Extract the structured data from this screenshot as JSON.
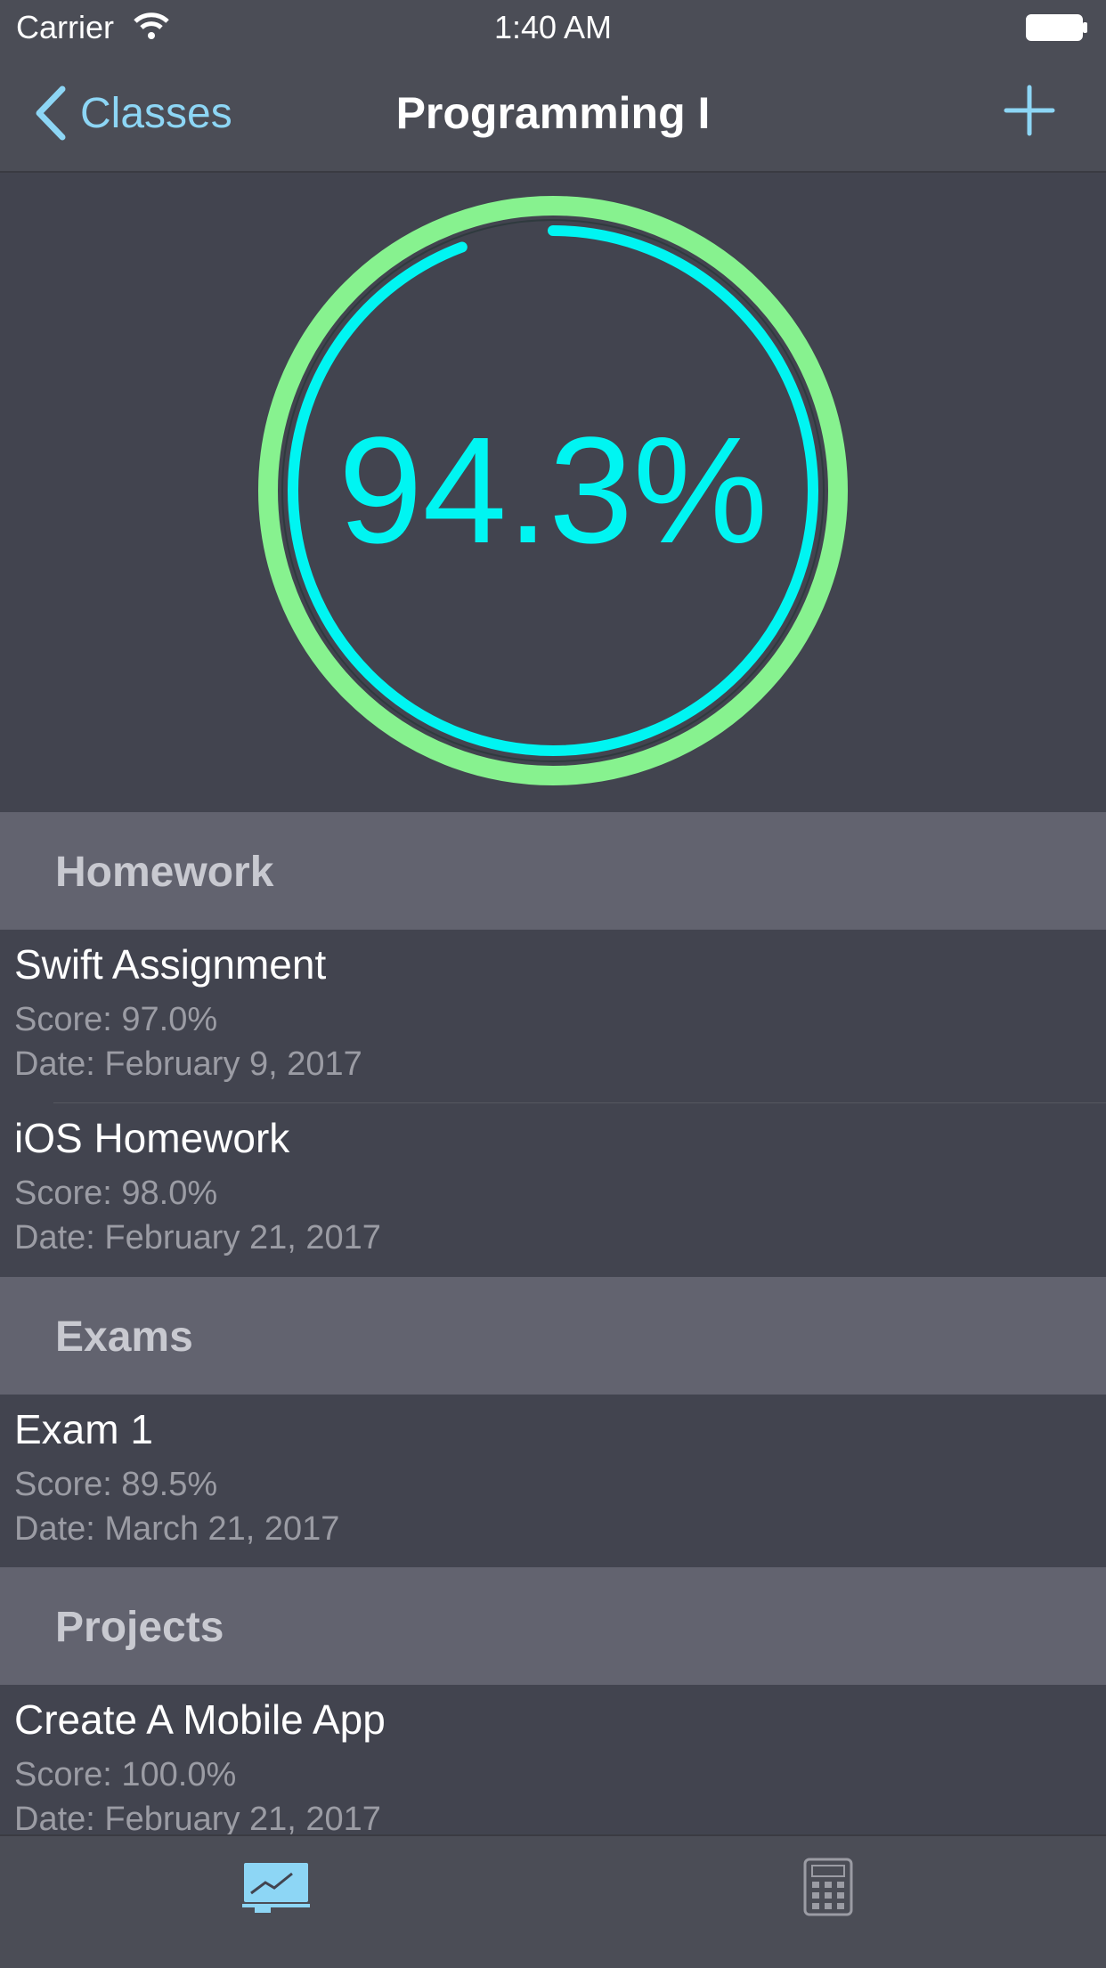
{
  "status_bar": {
    "carrier": "Carrier",
    "time": "1:40 AM"
  },
  "nav": {
    "back_label": "Classes",
    "title": "Programming I"
  },
  "grade": {
    "percent_text": "94.3%",
    "percent_value": 94.3
  },
  "colors": {
    "accent": "#8dd6f5",
    "ring_outer": "#87f28f",
    "ring_inner": "#00f5f2",
    "background": "#42444f",
    "header_bg": "#62636f"
  },
  "sections": [
    {
      "title": "Homework",
      "items": [
        {
          "name": "Swift Assignment",
          "score": "Score: 97.0%",
          "date": "Date: February 9, 2017"
        },
        {
          "name": "iOS Homework",
          "score": "Score: 98.0%",
          "date": "Date: February 21, 2017"
        }
      ]
    },
    {
      "title": "Exams",
      "items": [
        {
          "name": "Exam 1",
          "score": "Score: 89.5%",
          "date": "Date: March 21, 2017"
        }
      ]
    },
    {
      "title": "Projects",
      "items": [
        {
          "name": "Create A Mobile App",
          "score": "Score: 100.0%",
          "date": "Date: February 21, 2017"
        }
      ]
    }
  ],
  "icons": {
    "wifi": "wifi-icon",
    "battery": "battery-icon",
    "back": "chevron-left-icon",
    "add": "plus-icon",
    "tab1": "chart-board-icon",
    "tab2": "calculator-icon"
  }
}
